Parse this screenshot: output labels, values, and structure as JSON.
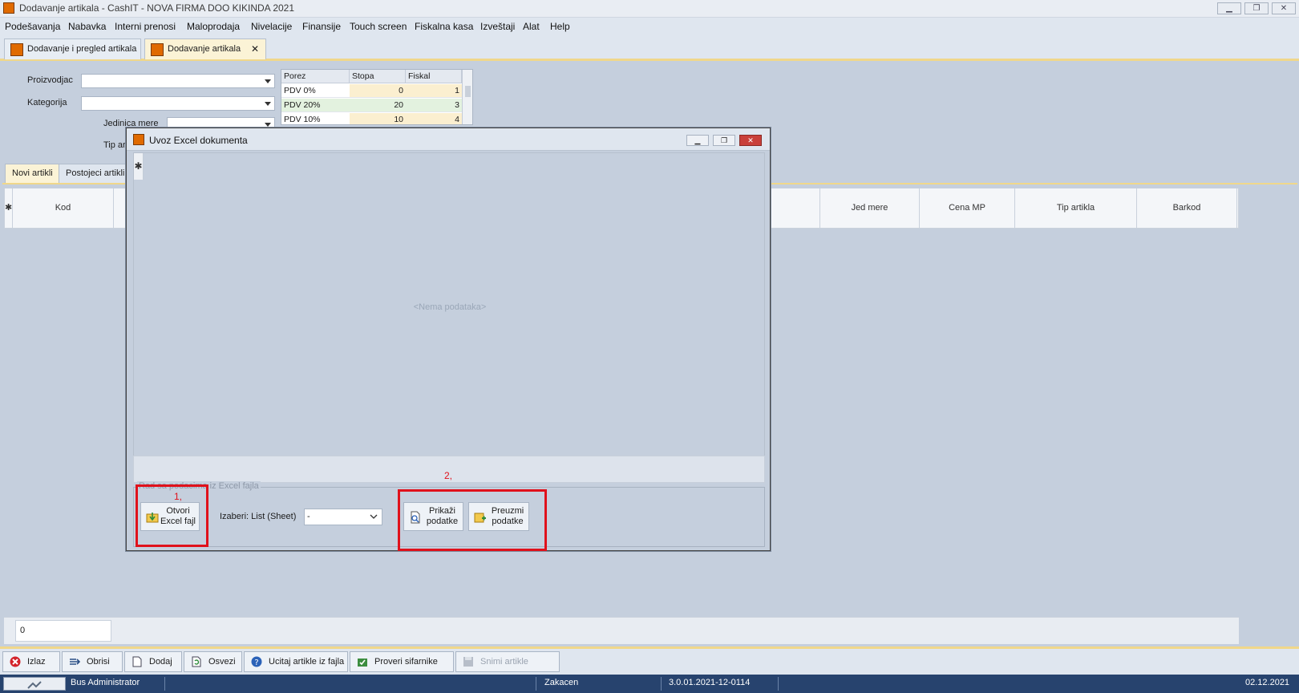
{
  "window": {
    "title": "Dodavanje artikala - CashIT - NOVA FIRMA DOO KIKINDA 2021",
    "min_glyph": "▁",
    "max_glyph": "❐",
    "close_glyph": "✕"
  },
  "menu": [
    "Podešavanja",
    "Nabavka",
    "Interni prenosi",
    "Maloprodaja",
    "Nivelacije",
    "Finansije",
    "Touch screen",
    "Fiskalna kasa",
    "Izveštaji",
    "Alat",
    "Help"
  ],
  "doc_tabs": [
    {
      "label": "Dodavanje i pregled artikala",
      "active": false
    },
    {
      "label": "Dodavanje artikala",
      "active": true,
      "close": "✕"
    }
  ],
  "form": {
    "proizvodjac_label": "Proizvodjac",
    "kategorija_label": "Kategorija",
    "jedinica_label": "Jedinica mere",
    "tip_label": "Tip ar",
    "proizvodjac_value": "",
    "kategorija_value": "",
    "jedinica_value": ""
  },
  "tax_grid": {
    "headers": [
      "Porez",
      "Stopa",
      "Fiskal"
    ],
    "rows": [
      {
        "porez": "PDV 0%",
        "stopa": "0",
        "fiskal": "1"
      },
      {
        "porez": "PDV 20%",
        "stopa": "20",
        "fiskal": "3"
      },
      {
        "porez": "PDV 10%",
        "stopa": "10",
        "fiskal": "4"
      }
    ]
  },
  "sub_tabs": [
    {
      "label": "Novi artikli",
      "active": true
    },
    {
      "label": "Postojeci artikli",
      "active": false
    }
  ],
  "grid": {
    "row_indicator": "✱",
    "columns": [
      "Kod",
      "Jed mere",
      "Cena MP",
      "Tip artikla",
      "Barkod"
    ],
    "footer_count": "0"
  },
  "toolbar": {
    "izlaz": "Izlaz",
    "obrisi": "Obrisi",
    "dodaj": "Dodaj",
    "osvezi": "Osvezi",
    "ucitaj": "Ucitaj artikle iz fajla",
    "proveri": "Proveri sifarnike",
    "snimi": "Snimi artikle"
  },
  "status": {
    "user": "Bus Administrator",
    "state": "Zakacen",
    "version": "3.0.01.2021-12-0114",
    "date": "02.12.2021"
  },
  "dialog": {
    "title": "Uvoz Excel dokumenta",
    "empty_text": "<Nema podataka>",
    "row_indicator": "✱",
    "group_title": "Rad sa podacima iz Excel fajla",
    "open_btn_line1": "Otvori",
    "open_btn_line2": "Excel fajl",
    "sheet_label": "Izaberi: List (Sheet)",
    "sheet_value": "-",
    "show_btn_line1": "Prikaži",
    "show_btn_line2": "podatke",
    "take_btn_line1": "Preuzmi",
    "take_btn_line2": "podatke",
    "marker1": "1,",
    "marker2": "2,"
  },
  "colors": {
    "accent_gold": "#f0d78a",
    "status_bar": "#27436e",
    "highlight_red": "#e0111b",
    "app_orange": "#e06a00"
  }
}
